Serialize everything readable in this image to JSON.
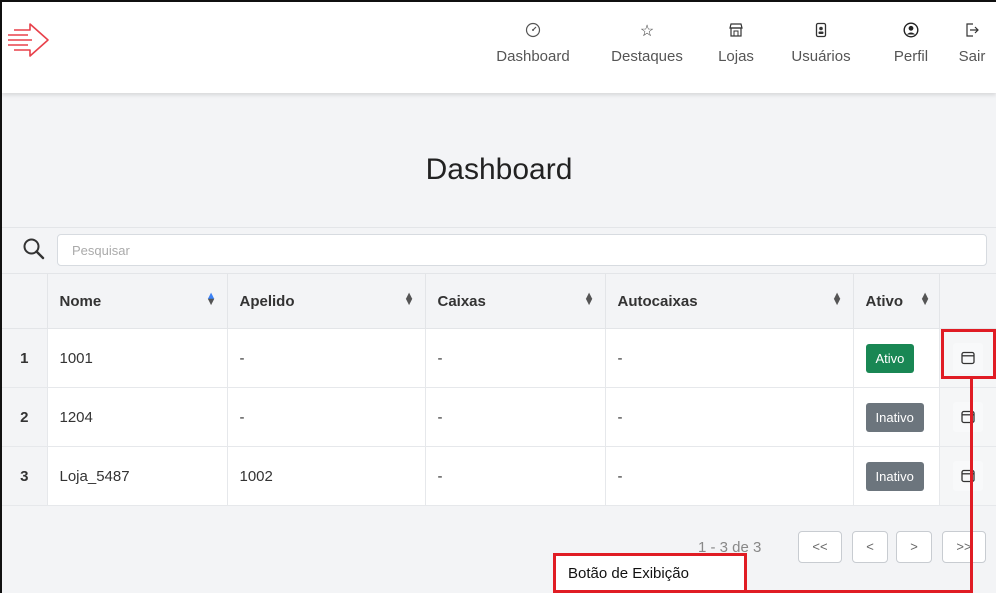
{
  "nav": {
    "items": [
      {
        "label": "Dashboard",
        "icon": "dashboard-gauge-icon"
      },
      {
        "label": "Destaques",
        "icon": "star-icon"
      },
      {
        "label": "Lojas",
        "icon": "store-icon"
      },
      {
        "label": "Usuários",
        "icon": "user-badge-icon"
      },
      {
        "label": "Perfil",
        "icon": "profile-icon"
      },
      {
        "label": "Sair",
        "icon": "logout-icon"
      }
    ]
  },
  "page": {
    "title": "Dashboard"
  },
  "search": {
    "placeholder": "Pesquisar",
    "value": ""
  },
  "table": {
    "columns": [
      "Nome",
      "Apelido",
      "Caixas",
      "Autocaixas",
      "Ativo"
    ],
    "rows": [
      {
        "index": "1",
        "nome": "1001",
        "apelido": "-",
        "caixas": "-",
        "autocaixas": "-",
        "ativo": "Ativo",
        "active": true
      },
      {
        "index": "2",
        "nome": "1204",
        "apelido": "-",
        "caixas": "-",
        "autocaixas": "-",
        "ativo": "Inativo",
        "active": false
      },
      {
        "index": "3",
        "nome": "Loja_5487",
        "apelido": "1002",
        "caixas": "-",
        "autocaixas": "-",
        "ativo": "Inativo",
        "active": false
      }
    ]
  },
  "pagination": {
    "info": "1 - 3 de 3",
    "first": "<<",
    "prev": "<",
    "next": ">",
    "last": ">>"
  },
  "annotation": {
    "label": "Botão de Exibição",
    "color": "#e01c24"
  },
  "colors": {
    "active_badge": "#198754",
    "inactive_badge": "#6c757d",
    "sort_active": "#3b82f6"
  }
}
